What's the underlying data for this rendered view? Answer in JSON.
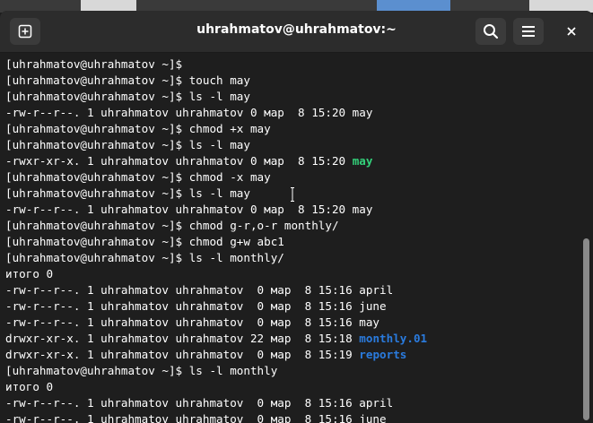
{
  "window": {
    "title": "uhrahmatov@uhrahmatov:~"
  },
  "colors": {
    "green": "#33d17a",
    "blue": "#2a7bde",
    "text": "#ffffff"
  },
  "terminal": {
    "lines": [
      {
        "parts": [
          {
            "text": "[uhrahmatov@uhrahmatov ~]$",
            "color": "#ffffff"
          }
        ]
      },
      {
        "parts": [
          {
            "text": "[uhrahmatov@uhrahmatov ~]$ touch may",
            "color": "#ffffff"
          }
        ]
      },
      {
        "parts": [
          {
            "text": "[uhrahmatov@uhrahmatov ~]$ ls -l may",
            "color": "#ffffff"
          }
        ]
      },
      {
        "parts": [
          {
            "text": "-rw-r--r--. 1 uhrahmatov uhrahmatov 0 мар  8 15:20 may",
            "color": "#ffffff"
          }
        ]
      },
      {
        "parts": [
          {
            "text": "[uhrahmatov@uhrahmatov ~]$ chmod +x may",
            "color": "#ffffff"
          }
        ]
      },
      {
        "parts": [
          {
            "text": "[uhrahmatov@uhrahmatov ~]$ ls -l may",
            "color": "#ffffff"
          }
        ]
      },
      {
        "parts": [
          {
            "text": "-rwxr-xr-x. 1 uhrahmatov uhrahmatov 0 мар  8 15:20 ",
            "color": "#ffffff"
          },
          {
            "text": "may",
            "color": "#33d17a",
            "bold": true
          }
        ]
      },
      {
        "parts": [
          {
            "text": "[uhrahmatov@uhrahmatov ~]$ chmod -x may",
            "color": "#ffffff"
          }
        ]
      },
      {
        "parts": [
          {
            "text": "[uhrahmatov@uhrahmatov ~]$ ls -l may",
            "color": "#ffffff"
          }
        ]
      },
      {
        "parts": [
          {
            "text": "-rw-r--r--. 1 uhrahmatov uhrahmatov 0 мар  8 15:20 may",
            "color": "#ffffff"
          }
        ]
      },
      {
        "parts": [
          {
            "text": "[uhrahmatov@uhrahmatov ~]$ chmod g-r,o-r monthly/",
            "color": "#ffffff"
          }
        ]
      },
      {
        "parts": [
          {
            "text": "[uhrahmatov@uhrahmatov ~]$ chmod g+w abc1",
            "color": "#ffffff"
          }
        ]
      },
      {
        "parts": [
          {
            "text": "[uhrahmatov@uhrahmatov ~]$ ls -l monthly/",
            "color": "#ffffff"
          }
        ]
      },
      {
        "parts": [
          {
            "text": "итого 0",
            "color": "#ffffff"
          }
        ]
      },
      {
        "parts": [
          {
            "text": "-rw-r--r--. 1 uhrahmatov uhrahmatov  0 мар  8 15:16 april",
            "color": "#ffffff"
          }
        ]
      },
      {
        "parts": [
          {
            "text": "-rw-r--r--. 1 uhrahmatov uhrahmatov  0 мар  8 15:16 june",
            "color": "#ffffff"
          }
        ]
      },
      {
        "parts": [
          {
            "text": "-rw-r--r--. 1 uhrahmatov uhrahmatov  0 мар  8 15:16 may",
            "color": "#ffffff"
          }
        ]
      },
      {
        "parts": [
          {
            "text": "drwxr-xr-x. 1 uhrahmatov uhrahmatov 22 мар  8 15:18 ",
            "color": "#ffffff"
          },
          {
            "text": "monthly.01",
            "color": "#2a7bde",
            "bold": true
          }
        ]
      },
      {
        "parts": [
          {
            "text": "drwxr-xr-x. 1 uhrahmatov uhrahmatov  0 мар  8 15:19 ",
            "color": "#ffffff"
          },
          {
            "text": "reports",
            "color": "#2a7bde",
            "bold": true
          }
        ]
      },
      {
        "parts": [
          {
            "text": "[uhrahmatov@uhrahmatov ~]$ ls -l monthly",
            "color": "#ffffff"
          }
        ]
      },
      {
        "parts": [
          {
            "text": "итого 0",
            "color": "#ffffff"
          }
        ]
      },
      {
        "parts": [
          {
            "text": "-rw-r--r--. 1 uhrahmatov uhrahmatov  0 мар  8 15:16 april",
            "color": "#ffffff"
          }
        ]
      },
      {
        "parts": [
          {
            "text": "-rw-r--r--. 1 uhrahmatov uhrahmatov  0 мар  8 15:16 june",
            "color": "#ffffff"
          }
        ]
      }
    ]
  },
  "icons": {
    "new_tab": "new-tab-icon",
    "search": "search-icon",
    "menu": "hamburger-menu-icon",
    "close": "close-icon"
  }
}
